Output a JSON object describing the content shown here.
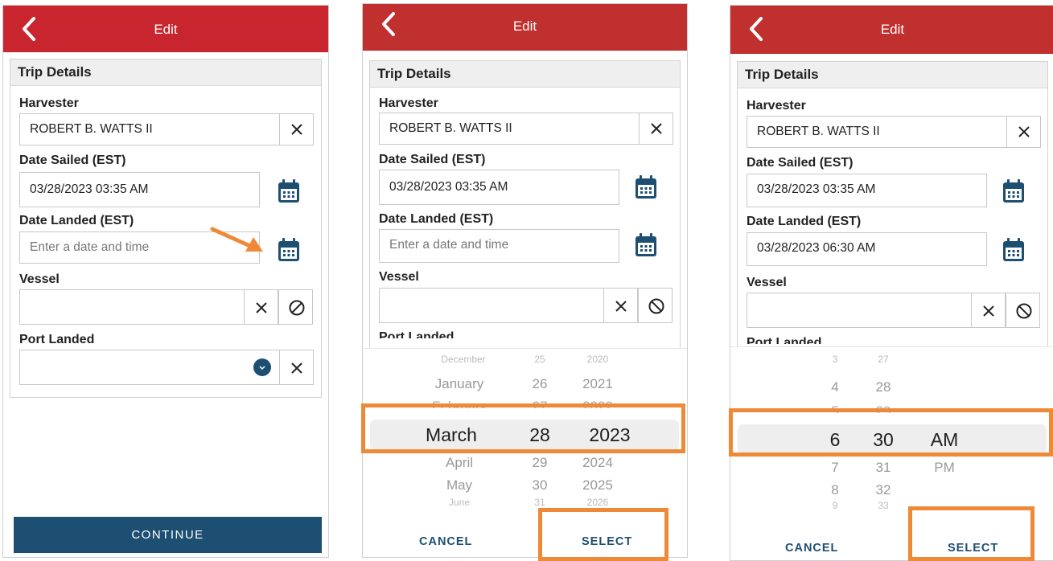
{
  "header": {
    "title": "Edit"
  },
  "form": {
    "section_title": "Trip Details",
    "harvester_label": "Harvester",
    "harvester_value": "ROBERT B. WATTS II",
    "date_sailed_label": "Date Sailed (EST)",
    "date_sailed_value": "03/28/2023 03:35 AM",
    "date_landed_label": "Date Landed (EST)",
    "date_landed_placeholder": "Enter a date and time",
    "date_landed_value_after": "03/28/2023 06:30 AM",
    "vessel_label": "Vessel",
    "port_landed_label": "Port Landed",
    "port_landed_partial": "Port Landed"
  },
  "buttons": {
    "continue": "CONTINUE",
    "cancel": "CANCEL",
    "select": "SELECT"
  },
  "date_picker": {
    "rows_above": [
      [
        "December",
        "25",
        "2020"
      ],
      [
        "January",
        "26",
        "2021"
      ],
      [
        "February",
        "27",
        "2022"
      ]
    ],
    "selected": [
      "March",
      "28",
      "2023"
    ],
    "rows_below": [
      [
        "April",
        "29",
        "2024"
      ],
      [
        "May",
        "30",
        "2025"
      ],
      [
        "June",
        "31",
        "2026"
      ]
    ]
  },
  "time_picker": {
    "rows_above": [
      [
        "3",
        "27",
        ""
      ],
      [
        "4",
        "28",
        ""
      ],
      [
        "5",
        "29",
        ""
      ]
    ],
    "selected": [
      "6",
      "30",
      "AM"
    ],
    "rows_below": [
      [
        "7",
        "31",
        "PM"
      ],
      [
        "8",
        "32",
        ""
      ],
      [
        "9",
        "33",
        ""
      ]
    ]
  },
  "colors": {
    "header": "#c9252e",
    "primary": "#1d4f72",
    "highlight": "#ee8a37"
  },
  "icons": [
    "back-chevron-icon",
    "close-icon",
    "calendar-icon",
    "no-entry-icon",
    "chevron-down-icon",
    "arrow-icon"
  ]
}
